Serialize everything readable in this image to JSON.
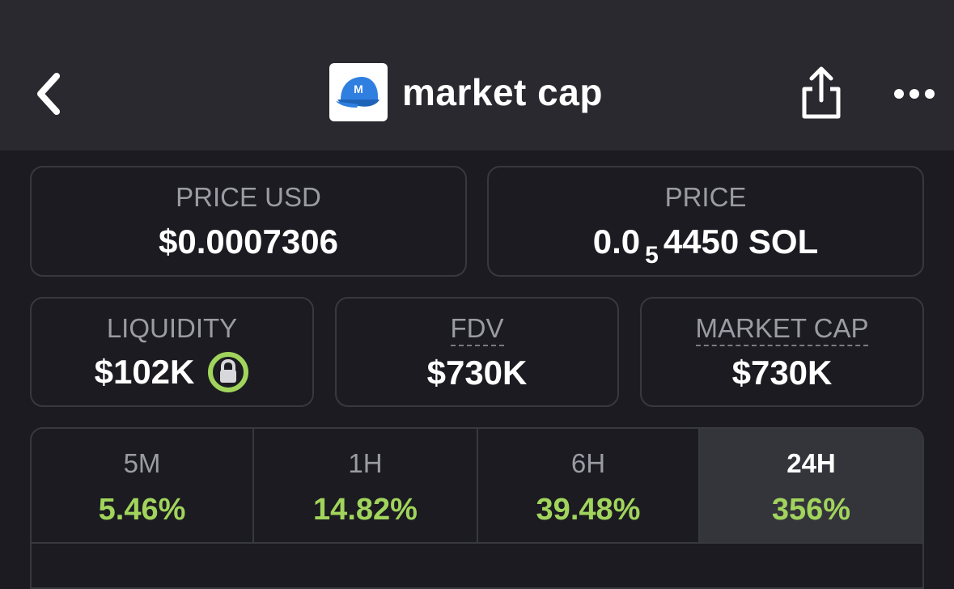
{
  "header": {
    "title": "market cap",
    "logo_letter": "M"
  },
  "price_usd": {
    "label": "PRICE USD",
    "value": "$0.0007306"
  },
  "price_sol": {
    "label": "PRICE",
    "prefix": "0.0",
    "subscript": "5",
    "suffix": "4450 SOL"
  },
  "liquidity": {
    "label": "LIQUIDITY",
    "value": "$102K"
  },
  "fdv": {
    "label": "FDV",
    "value": "$730K"
  },
  "market_cap": {
    "label": "MARKET CAP",
    "value": "$730K"
  },
  "timeframes": [
    {
      "label": "5M",
      "change": "5.46%"
    },
    {
      "label": "1H",
      "change": "14.82%"
    },
    {
      "label": "6H",
      "change": "39.48%"
    },
    {
      "label": "24H",
      "change": "356%"
    }
  ],
  "colors": {
    "positive": "#a1d45c",
    "lock_ring": "#a1d45c",
    "logo_cap": "#2f7fe0"
  }
}
